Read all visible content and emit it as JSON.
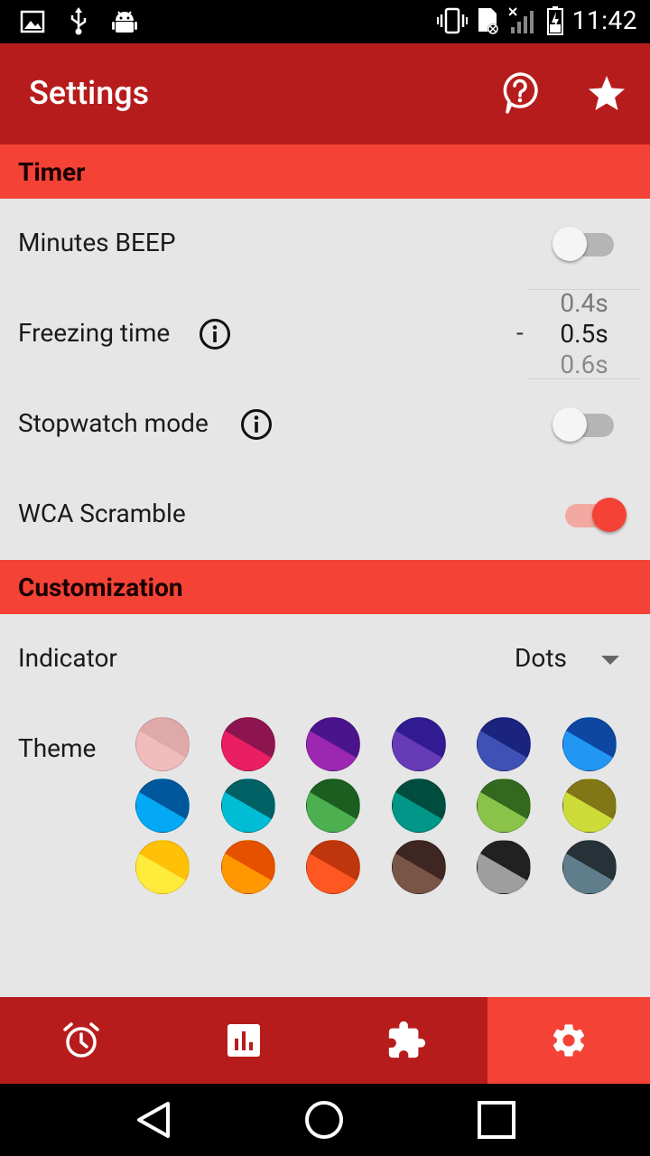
{
  "status_bar": {
    "time": "11:42",
    "left_icons": [
      "image-icon",
      "usb-icon",
      "android-icon"
    ],
    "right_icons": [
      "vibrate-icon",
      "sim-icon",
      "signal-icon",
      "battery-charging-icon"
    ]
  },
  "app_bar": {
    "title": "Settings",
    "actions": [
      "help-icon",
      "star-icon"
    ]
  },
  "sections": {
    "timer": {
      "title": "Timer"
    },
    "customization": {
      "title": "Customization"
    }
  },
  "timer": {
    "minutes_beep": {
      "label": "Minutes BEEP",
      "enabled": false
    },
    "freezing_time": {
      "label": "Freezing time",
      "dash": "-",
      "options": [
        "0.4s",
        "0.5s",
        "0.6s"
      ],
      "selected": "0.5s"
    },
    "stopwatch_mode": {
      "label": "Stopwatch mode",
      "enabled": false
    },
    "wca_scramble": {
      "label": "WCA Scramble",
      "enabled": true
    }
  },
  "customization": {
    "indicator": {
      "label": "Indicator",
      "value": "Dots"
    },
    "theme": {
      "label": "Theme",
      "swatches": [
        [
          "#e0a9a9",
          "#f0bcbc"
        ],
        [
          "#8e1450",
          "#e91e63"
        ],
        [
          "#4a148c",
          "#9c27b0"
        ],
        [
          "#311b92",
          "#673ab7"
        ],
        [
          "#1a237e",
          "#3f51b5"
        ],
        [
          "#0d47a1",
          "#2196f3"
        ],
        [
          "#01579b",
          "#03a9f4"
        ],
        [
          "#006064",
          "#00bcd4"
        ],
        [
          "#1b5e20",
          "#4caf50"
        ],
        [
          "#004d40",
          "#009688"
        ],
        [
          "#33691e",
          "#8bc34a"
        ],
        [
          "#827717",
          "#cddc39"
        ],
        [
          "#ffc107",
          "#ffeb3b"
        ],
        [
          "#e65100",
          "#ff9800"
        ],
        [
          "#bf360c",
          "#ff5722"
        ],
        [
          "#3e2723",
          "#795548"
        ],
        [
          "#212121",
          "#9e9e9e"
        ],
        [
          "#263238",
          "#607d8b"
        ]
      ]
    }
  },
  "bottom_nav": {
    "items": [
      "alarm-clock-icon",
      "stats-icon",
      "puzzle-icon",
      "gear-icon"
    ],
    "active_index": 3
  },
  "system_nav": [
    "back-icon",
    "home-icon",
    "recents-icon"
  ]
}
